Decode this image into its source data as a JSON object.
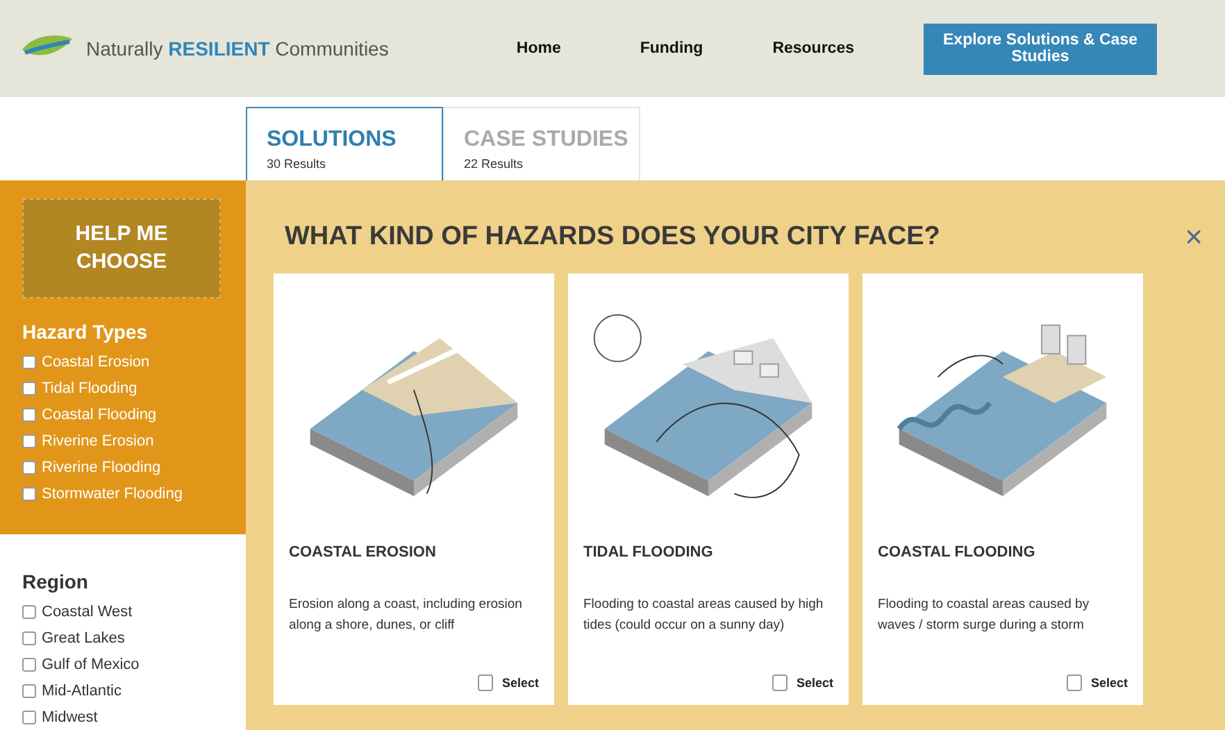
{
  "header": {
    "logo_text": {
      "prefix": "Naturally",
      "highlight": "RESILIENT",
      "suffix": "Communities"
    },
    "nav": [
      {
        "label": "Home"
      },
      {
        "label": "Funding"
      },
      {
        "label": "Resources"
      }
    ],
    "cta": "Explore Solutions & Case Studies"
  },
  "tabs": [
    {
      "label": "SOLUTIONS",
      "count": "30 Results",
      "selected": true
    },
    {
      "label": "CASE STUDIES",
      "count": "22 Results",
      "selected": false
    }
  ],
  "sidebar": {
    "help_button": "HELP ME CHOOSE",
    "hazard_title": "Hazard Types",
    "hazards": [
      {
        "label": "Coastal Erosion",
        "checked": false
      },
      {
        "label": "Tidal Flooding",
        "checked": false
      },
      {
        "label": "Coastal Flooding",
        "checked": false
      },
      {
        "label": "Riverine Erosion",
        "checked": false
      },
      {
        "label": "Riverine Flooding",
        "checked": false
      },
      {
        "label": "Stormwater Flooding",
        "checked": false
      }
    ],
    "region_title": "Region",
    "regions": [
      {
        "label": "Coastal West",
        "checked": false
      },
      {
        "label": "Great Lakes",
        "checked": false
      },
      {
        "label": "Gulf of Mexico",
        "checked": false
      },
      {
        "label": "Mid-Atlantic",
        "checked": false
      },
      {
        "label": "Midwest",
        "checked": false
      }
    ]
  },
  "modal": {
    "title": "WHAT KIND OF HAZARDS DOES YOUR CITY FACE?",
    "close": "×",
    "cards": [
      {
        "kind": "erosion",
        "title": "COASTAL EROSION",
        "description": "Erosion along a coast, including erosion along a shore, dunes, or cliff",
        "select_label": "Select",
        "selected": false
      },
      {
        "kind": "tidal",
        "title": "TIDAL FLOODING",
        "description": "Flooding to coastal areas caused by high tides (could occur on a sunny day)",
        "select_label": "Select",
        "selected": false
      },
      {
        "kind": "surge",
        "title": "COASTAL FLOODING",
        "description": "Flooding to coastal areas caused by waves / storm surge during a storm",
        "select_label": "Select",
        "selected": false
      }
    ]
  }
}
